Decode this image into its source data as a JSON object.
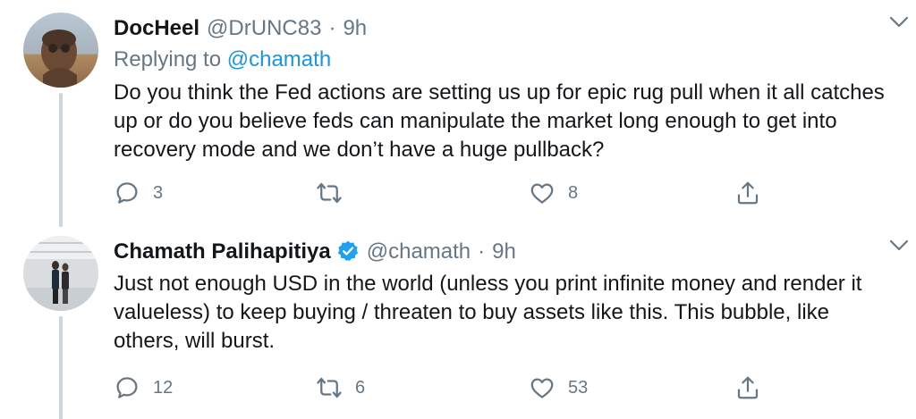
{
  "tweets": [
    {
      "display_name": "DocHeel",
      "handle": "@DrUNC83",
      "separator": "·",
      "time": "9h",
      "replying_prefix": "Replying to",
      "replying_to": "@chamath",
      "text": "Do you think the Fed actions are setting us up for epic rug pull when it all catches up or do you believe feds can manipulate the market long enough to get into recovery mode and we don’t have a huge pullback?",
      "replies": "3",
      "retweets": "",
      "likes": "8",
      "avatar_icon": "user-avatar",
      "verified": false
    },
    {
      "display_name": "Chamath Palihapitiya",
      "handle": "@chamath",
      "separator": "·",
      "time": "9h",
      "text": "Just not enough USD in the world (unless you print infinite money and render it valueless) to keep buying / threaten to buy assets like this. This bubble, like others, will burst.",
      "replies": "12",
      "retweets": "6",
      "likes": "53",
      "avatar_icon": "user-avatar",
      "verified": true
    }
  ],
  "icons": [
    "reply-icon",
    "retweet-icon",
    "like-icon",
    "share-icon",
    "chevron-down-icon",
    "verified-badge-icon"
  ],
  "colors": {
    "text": "#14171a",
    "secondary": "#657786",
    "link": "#1b95e0",
    "thread_line": "#ccd6dd",
    "verified": "#1da1f2"
  }
}
